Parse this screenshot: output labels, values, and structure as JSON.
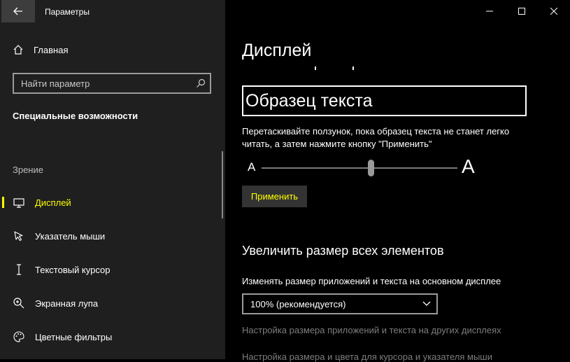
{
  "app": {
    "title": "Параметры"
  },
  "sidebar": {
    "home_label": "Главная",
    "search_placeholder": "Найти параметр",
    "section_title": "Специальные возможности",
    "group_label": "Зрение",
    "items": [
      {
        "label": "Дисплей",
        "icon": "monitor-icon",
        "selected": true
      },
      {
        "label": "Указатель мыши",
        "icon": "mouse-pointer-icon",
        "selected": false
      },
      {
        "label": "Текстовый курсор",
        "icon": "text-cursor-icon",
        "selected": false
      },
      {
        "label": "Экранная лупа",
        "icon": "magnifier-icon",
        "selected": false
      },
      {
        "label": "Цветные фильтры",
        "icon": "palette-icon",
        "selected": false
      }
    ]
  },
  "main": {
    "page_title": "Дисплей",
    "sample_text": "Образец текста",
    "slider_description": "Перетаскивайте ползунок, пока образец текста не станет легко читать, а затем нажмите кнопку \"Применить\"",
    "slider_small_label": "A",
    "slider_large_label": "A",
    "slider_value": 0.56,
    "apply_label": "Применить",
    "scale_heading": "Увеличить размер всех элементов",
    "scale_dropdown_label": "Изменять размер приложений и текста на основном дисплее",
    "scale_dropdown_value": "100% (рекомендуется)",
    "link_other_displays": "Настройка размера приложений и текста на других дисплеях",
    "link_cursor": "Настройка размера и цвета для курсора и указателя мыши"
  },
  "colors": {
    "sidebar_bg": "#1f1f1f",
    "main_bg": "#000000",
    "accent": "#ffff00",
    "muted_text": "#7d7d7d"
  }
}
